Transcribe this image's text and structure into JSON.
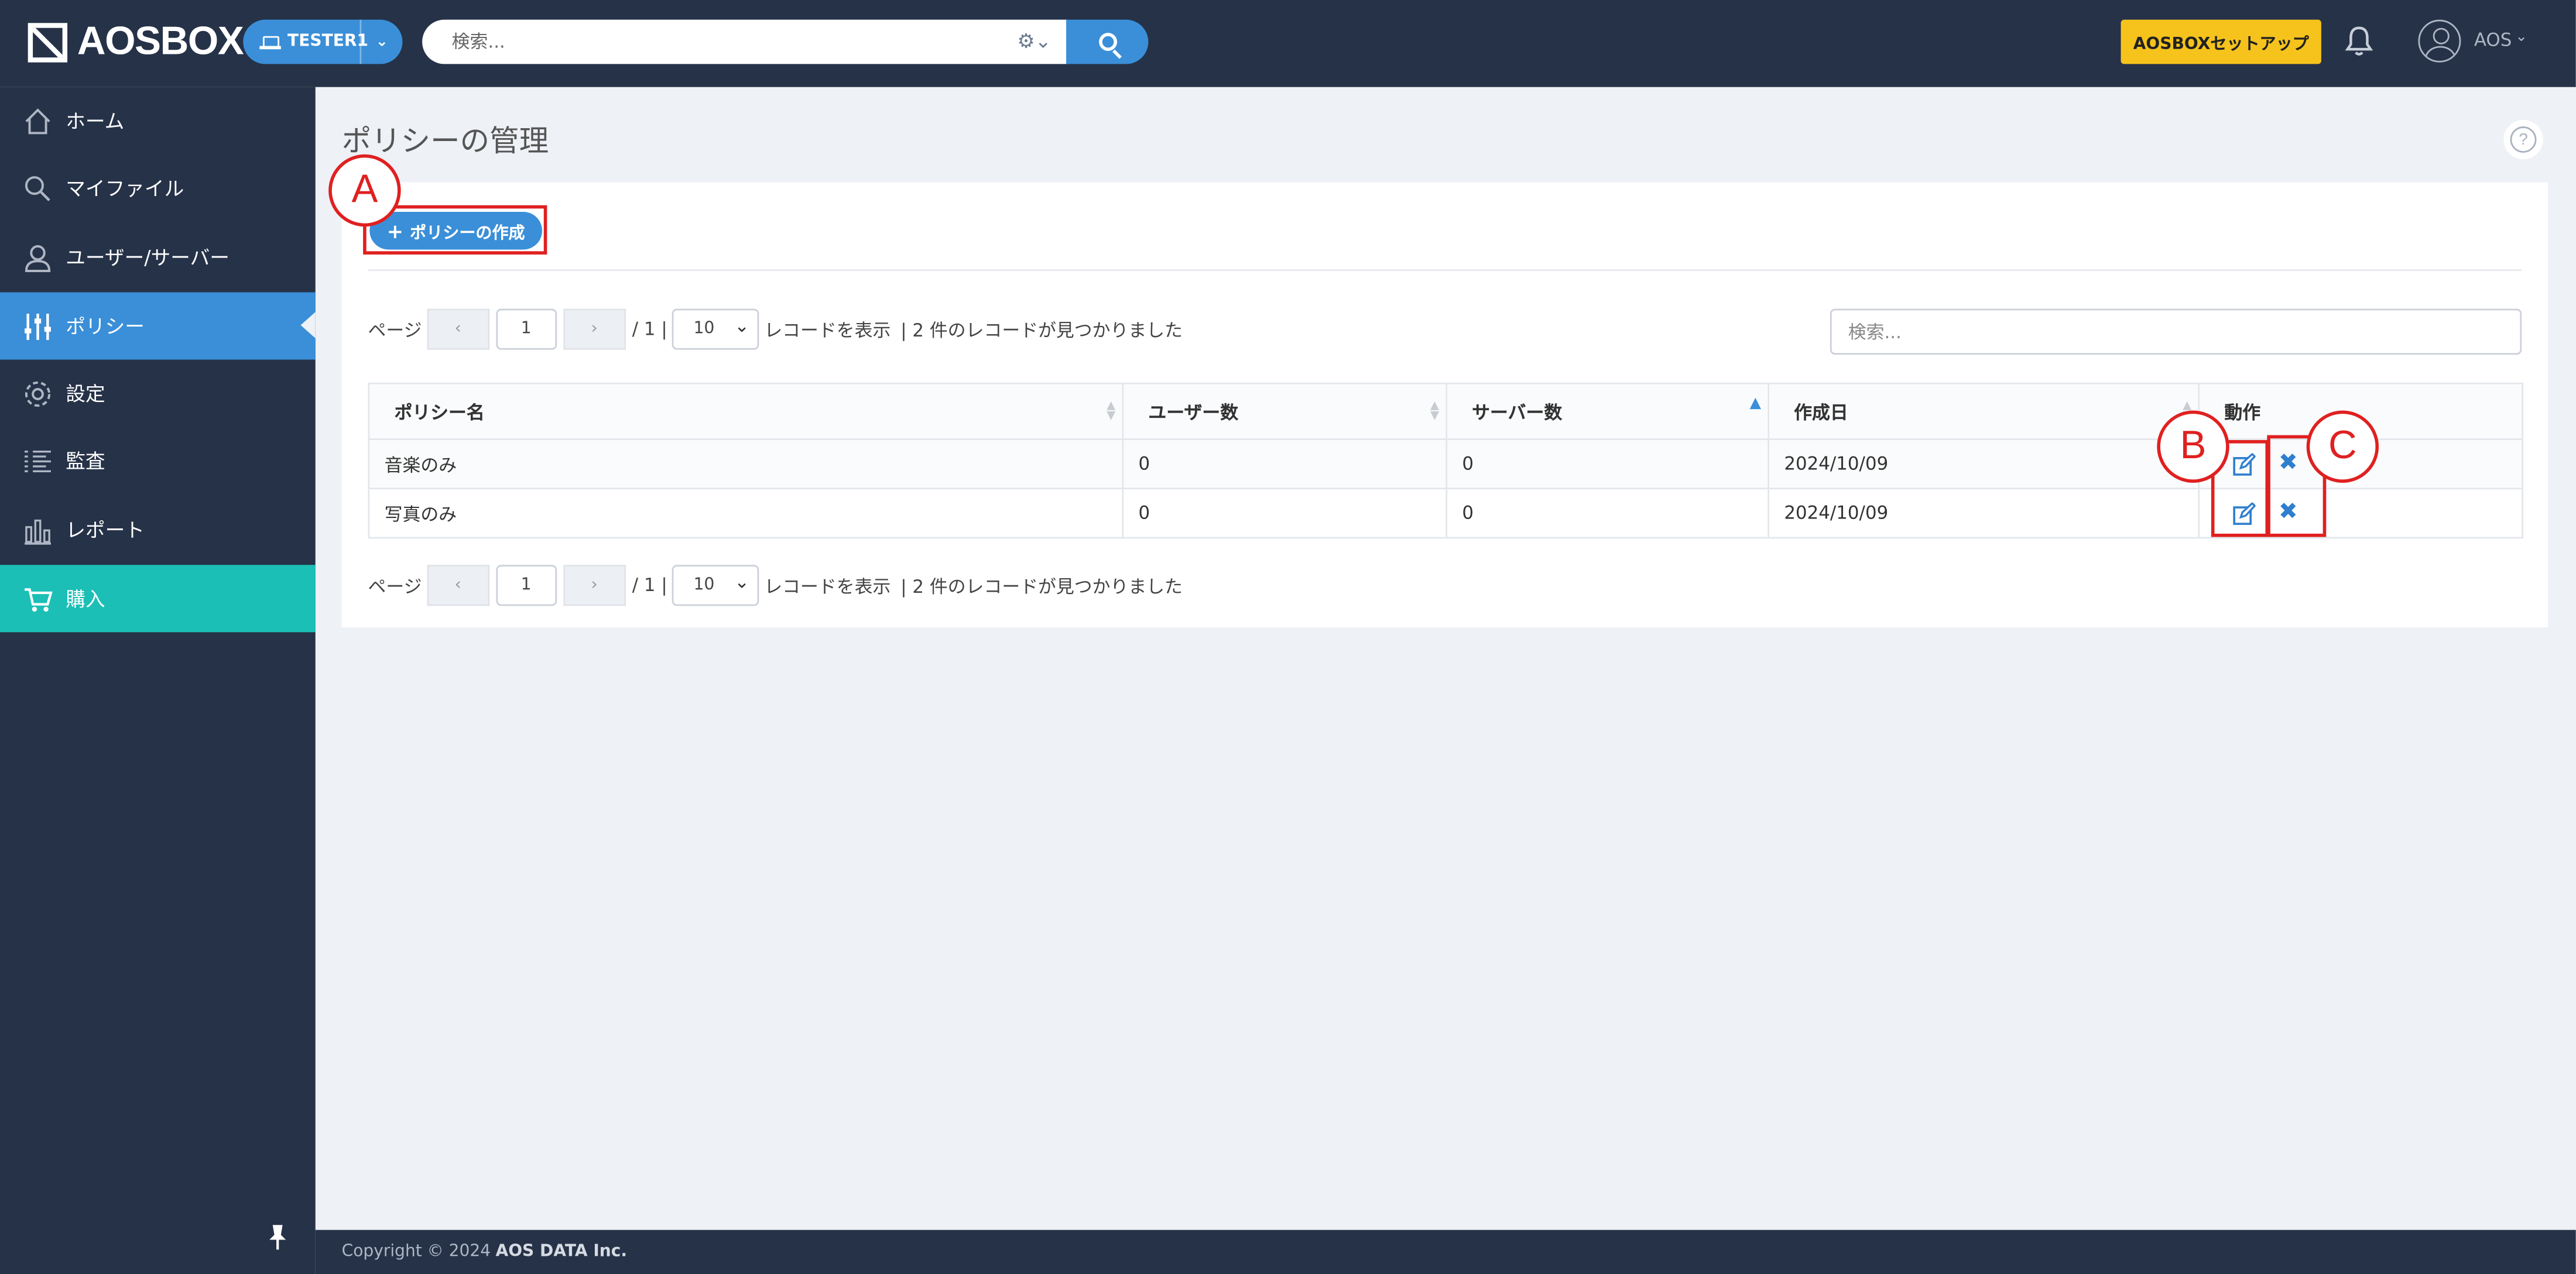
{
  "header": {
    "logo_text": "AOSBOX",
    "tenant_label": "TESTER1",
    "search_placeholder": "検索...",
    "setup_button": "AOSBOXセットアップ",
    "user_name": "AOS"
  },
  "sidebar": {
    "items": [
      {
        "label": "ホーム",
        "icon": "home-icon"
      },
      {
        "label": "マイファイル",
        "icon": "search-icon"
      },
      {
        "label": "ユーザー/サーバー",
        "icon": "user-icon"
      },
      {
        "label": "ポリシー",
        "icon": "sliders-icon"
      },
      {
        "label": "設定",
        "icon": "gear-icon"
      },
      {
        "label": "監査",
        "icon": "list-icon"
      },
      {
        "label": "レポート",
        "icon": "bar-chart-icon"
      },
      {
        "label": "購入",
        "icon": "cart-icon"
      }
    ],
    "active": "ポリシー"
  },
  "main": {
    "title": "ポリシーの管理",
    "create_button": "ポリシーの作成",
    "table_search_placeholder": "検索...",
    "pager": {
      "page_label": "ページ",
      "prev": "‹",
      "next": "›",
      "current_page": "1",
      "total_pages": "/ 1 |",
      "page_size": "10",
      "records_label": "レコードを表示",
      "found_text": "| 2 件のレコードが見つかりました"
    },
    "table": {
      "columns": [
        "ポリシー名",
        "ユーザー数",
        "サーバー数",
        "作成日",
        "動作"
      ],
      "rows": [
        {
          "name": "音楽のみ",
          "users": "0",
          "servers": "0",
          "created": "2024/10/09"
        },
        {
          "name": "写真のみ",
          "users": "0",
          "servers": "0",
          "created": "2024/10/09"
        }
      ]
    }
  },
  "annotations": {
    "a": "A",
    "b": "B",
    "c": "C"
  },
  "footer": {
    "copyright": "Copyright © 2024",
    "company": "AOS DATA Inc."
  },
  "colors": {
    "navy": "#263248",
    "accent_blue": "#3a8fd8",
    "teal": "#1bbfb6",
    "yellow": "#f5c31c",
    "annotation_red": "#e02020"
  }
}
